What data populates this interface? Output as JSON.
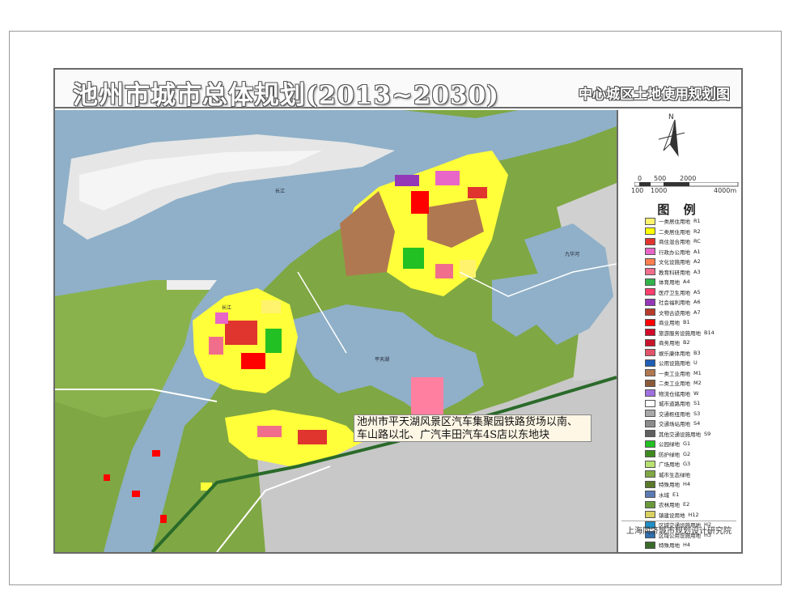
{
  "map": {
    "title": "池州市城市总体规划(2013~2030)",
    "subtitle": "中心城区土地使用规划图",
    "north_label": "N",
    "scale_top": [
      "0",
      "500",
      "2000"
    ],
    "scale_bottom": [
      "100",
      "1000",
      "4000m"
    ],
    "place_labels": [
      "长江",
      "长江",
      "平天湖",
      "九华河"
    ],
    "annotation_line1": "池州市平天湖风景区汽车集聚园铁路货场以南、",
    "annotation_line2": "车山路以北、广汽丰田汽车4S店以东地块",
    "institute": "上海同济城市规划设计研究院",
    "colors": {
      "water": "#8fb0c8",
      "ecology_green": "#7fa743",
      "urban_gray": "#c9c9c9"
    }
  },
  "legend": {
    "title": "图 例",
    "items": [
      {
        "label": "一类居住用地",
        "code": "R1",
        "color": "#fff36e"
      },
      {
        "label": "二类居住用地",
        "code": "R2",
        "color": "#ffff00"
      },
      {
        "label": "商住混合用地",
        "code": "RC",
        "color": "#e0342e"
      },
      {
        "label": "行政办公用地",
        "code": "A1",
        "color": "#e866c8"
      },
      {
        "label": "文化设施用地",
        "code": "A2",
        "color": "#ff7f50"
      },
      {
        "label": "教育科研用地",
        "code": "A3",
        "color": "#f06e8c"
      },
      {
        "label": "体育用地",
        "code": "A4",
        "color": "#2fb34a"
      },
      {
        "label": "医疗卫生用地",
        "code": "A5",
        "color": "#ff3e6c"
      },
      {
        "label": "社会福利用地",
        "code": "A6",
        "color": "#9438b8"
      },
      {
        "label": "文物古迹用地",
        "code": "A7",
        "color": "#b83a2a"
      },
      {
        "label": "商业用地",
        "code": "B1",
        "color": "#ff0000"
      },
      {
        "label": "旅游服务设施用地",
        "code": "B14",
        "color": "#d10a2a"
      },
      {
        "label": "商务用地",
        "code": "B2",
        "color": "#c8142a"
      },
      {
        "label": "娱乐康体用地",
        "code": "B3",
        "color": "#e0546a"
      },
      {
        "label": "公用设施用地",
        "code": "U",
        "color": "#1e5eb4"
      },
      {
        "label": "一类工业用地",
        "code": "M1",
        "color": "#b07850"
      },
      {
        "label": "二类工业用地",
        "code": "M2",
        "color": "#8c5a38"
      },
      {
        "label": "物流仓储用地",
        "code": "W",
        "color": "#a070e0"
      },
      {
        "label": "城市道路用地",
        "code": "S1",
        "color": "#ffffff"
      },
      {
        "label": "交通枢纽用地",
        "code": "S3",
        "color": "#a8a8a8"
      },
      {
        "label": "交通场站用地",
        "code": "S4",
        "color": "#8c8c8c"
      },
      {
        "label": "其他交通设施用地",
        "code": "S9",
        "color": "#606060"
      },
      {
        "label": "公园绿地",
        "code": "G1",
        "color": "#22c022"
      },
      {
        "label": "防护绿地",
        "code": "G2",
        "color": "#3e8a1e"
      },
      {
        "label": "广场用地",
        "code": "G3",
        "color": "#b8e070"
      },
      {
        "label": "城市生态绿地",
        "code": "",
        "color": "#7fa743"
      },
      {
        "label": "特殊用地",
        "code": "H4",
        "color": "#5a7a2a"
      },
      {
        "label": "水域",
        "code": "E1",
        "color": "#5a7ab4"
      },
      {
        "label": "农林用地",
        "code": "E2",
        "color": "#6a9a3a"
      },
      {
        "label": "镇建设用地",
        "code": "H12",
        "color": "#d8d060"
      },
      {
        "label": "区域交通设施用地",
        "code": "H2",
        "color": "#2090c8"
      },
      {
        "label": "区域公用设施用地",
        "code": "H3",
        "color": "#3070b0"
      },
      {
        "label": "特殊用地",
        "code": "H4",
        "color": "#3a6a2a"
      }
    ]
  }
}
